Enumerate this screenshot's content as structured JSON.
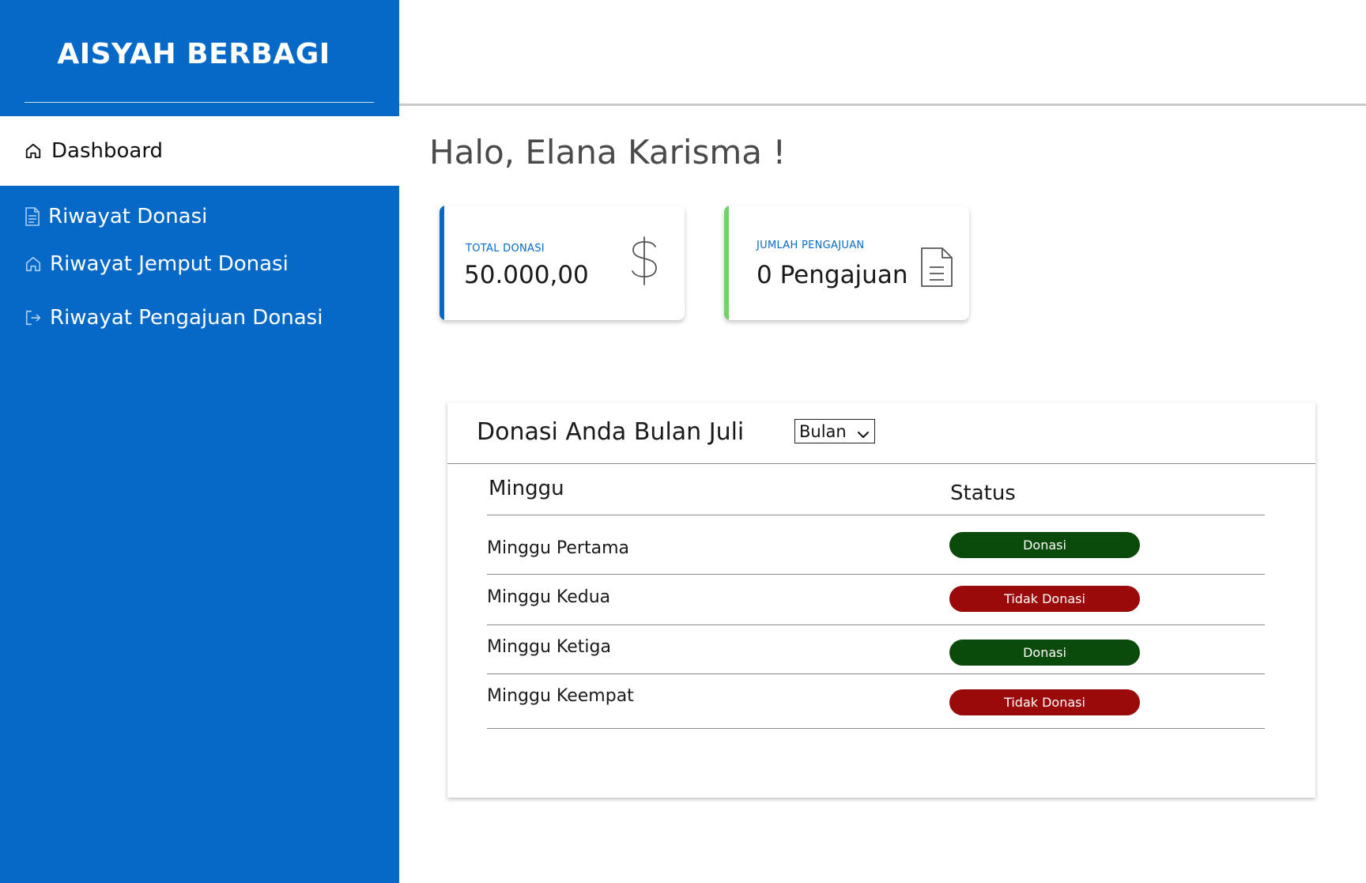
{
  "sidebar": {
    "brand": "AISYAH BERBAGI",
    "active_item": {
      "label": "Dashboard",
      "icon": "home-icon"
    },
    "items": [
      {
        "label": "Riwayat Donasi",
        "icon": "document-icon"
      },
      {
        "label": "Riwayat Jemput Donasi",
        "icon": "home-icon"
      },
      {
        "label": "Riwayat Pengajuan Donasi",
        "icon": "sign-out-icon"
      }
    ]
  },
  "main": {
    "greeting": "Halo, Elana Karisma !",
    "cards": [
      {
        "caption": "TOTAL DONASI",
        "value": "50.000,00",
        "icon": "dollar-icon",
        "accent": "#0669c8"
      },
      {
        "caption": "JUMLAH PENGAJUAN",
        "value": "0 Pengajuan",
        "icon": "document-icon",
        "accent": "#6fd36a"
      }
    ],
    "panel": {
      "title": "Donasi Anda Bulan Juli",
      "select_value": "Bulan",
      "headers": {
        "week": "Minggu",
        "status": "Status"
      },
      "rows": [
        {
          "week": "Minggu Pertama",
          "status": "Donasi",
          "color": "#0a4a0a"
        },
        {
          "week": "Minggu Kedua",
          "status": "Tidak Donasi",
          "color": "#9b0a0a"
        },
        {
          "week": "Minggu Ketiga",
          "status": "Donasi",
          "color": "#0a4a0a"
        },
        {
          "week": "Minggu Keempat",
          "status": "Tidak Donasi",
          "color": "#9b0a0a"
        }
      ]
    }
  },
  "colors": {
    "primary": "#0669c8",
    "success": "#0a4a0a",
    "danger": "#9b0a0a"
  }
}
